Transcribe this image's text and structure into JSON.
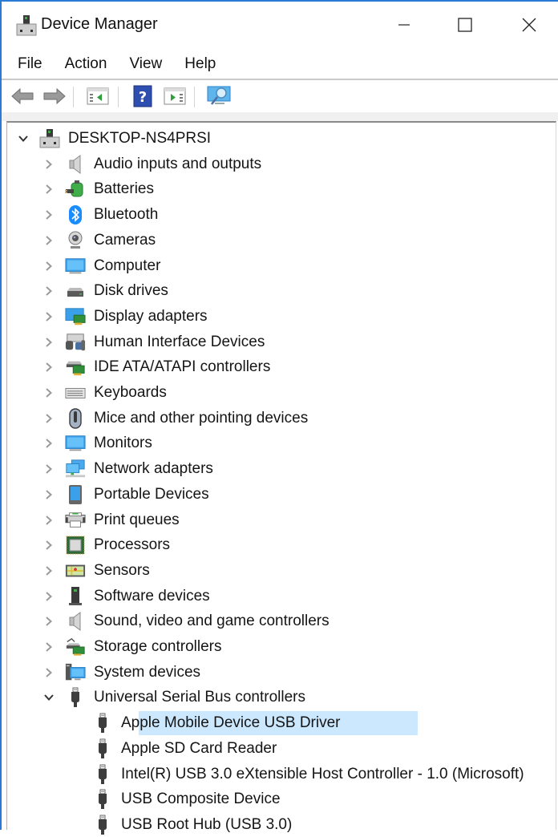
{
  "window": {
    "title": "Device Manager",
    "controls": {
      "minimize": "minimize",
      "maximize": "maximize",
      "close": "close"
    }
  },
  "menu": [
    "File",
    "Action",
    "View",
    "Help"
  ],
  "toolbar": {
    "buttons": [
      {
        "name": "back",
        "icon": "back-arrow-icon"
      },
      {
        "name": "forward",
        "icon": "forward-arrow-icon"
      },
      {
        "name": "show-hide-console-tree",
        "icon": "console-tree-icon"
      },
      {
        "name": "help",
        "icon": "help-icon",
        "glyph": "?"
      },
      {
        "name": "show-hide-action-pane",
        "icon": "action-pane-icon"
      },
      {
        "name": "scan-hardware-changes",
        "icon": "scan-monitor-icon"
      }
    ]
  },
  "tree": {
    "root": {
      "label": "DESKTOP-NS4PRSI",
      "expanded": true,
      "icon": "computer-tower-icon"
    },
    "categories": [
      {
        "label": "Audio inputs and outputs",
        "icon": "speaker-icon",
        "expanded": false
      },
      {
        "label": "Batteries",
        "icon": "battery-icon",
        "expanded": false
      },
      {
        "label": "Bluetooth",
        "icon": "bluetooth-icon",
        "expanded": false
      },
      {
        "label": "Cameras",
        "icon": "webcam-icon",
        "expanded": false
      },
      {
        "label": "Computer",
        "icon": "monitor-icon",
        "expanded": false
      },
      {
        "label": "Disk drives",
        "icon": "disk-drive-icon",
        "expanded": false
      },
      {
        "label": "Display adapters",
        "icon": "display-adapter-icon",
        "expanded": false
      },
      {
        "label": "Human Interface Devices",
        "icon": "hid-icon",
        "expanded": false
      },
      {
        "label": "IDE ATA/ATAPI controllers",
        "icon": "ide-controller-icon",
        "expanded": false
      },
      {
        "label": "Keyboards",
        "icon": "keyboard-icon",
        "expanded": false
      },
      {
        "label": "Mice and other pointing devices",
        "icon": "mouse-icon",
        "expanded": false
      },
      {
        "label": "Monitors",
        "icon": "monitor-icon",
        "expanded": false
      },
      {
        "label": "Network adapters",
        "icon": "network-adapter-icon",
        "expanded": false
      },
      {
        "label": "Portable Devices",
        "icon": "portable-device-icon",
        "expanded": false
      },
      {
        "label": "Print queues",
        "icon": "printer-icon",
        "expanded": false
      },
      {
        "label": "Processors",
        "icon": "processor-icon",
        "expanded": false
      },
      {
        "label": "Sensors",
        "icon": "sensor-icon",
        "expanded": false
      },
      {
        "label": "Software devices",
        "icon": "software-device-icon",
        "expanded": false
      },
      {
        "label": "Sound, video and game controllers",
        "icon": "speaker-icon",
        "expanded": false
      },
      {
        "label": "Storage controllers",
        "icon": "storage-controller-icon",
        "expanded": false
      },
      {
        "label": "System devices",
        "icon": "system-device-icon",
        "expanded": false
      },
      {
        "label": "Universal Serial Bus controllers",
        "icon": "usb-plug-icon",
        "expanded": true,
        "children": [
          {
            "label": "Apple Mobile Device USB Driver",
            "icon": "usb-plug-icon",
            "selected": true
          },
          {
            "label": "Apple SD Card Reader",
            "icon": "usb-plug-icon",
            "selected": false
          },
          {
            "label": "Intel(R) USB 3.0 eXtensible Host Controller - 1.0 (Microsoft)",
            "icon": "usb-plug-icon",
            "selected": false
          },
          {
            "label": "USB Composite Device",
            "icon": "usb-plug-icon",
            "selected": false
          },
          {
            "label": "USB Root Hub (USB 3.0)",
            "icon": "usb-plug-icon",
            "selected": false
          }
        ]
      }
    ]
  },
  "colors": {
    "accent_border": "#2b7bd6",
    "selection": "#cce8ff"
  }
}
